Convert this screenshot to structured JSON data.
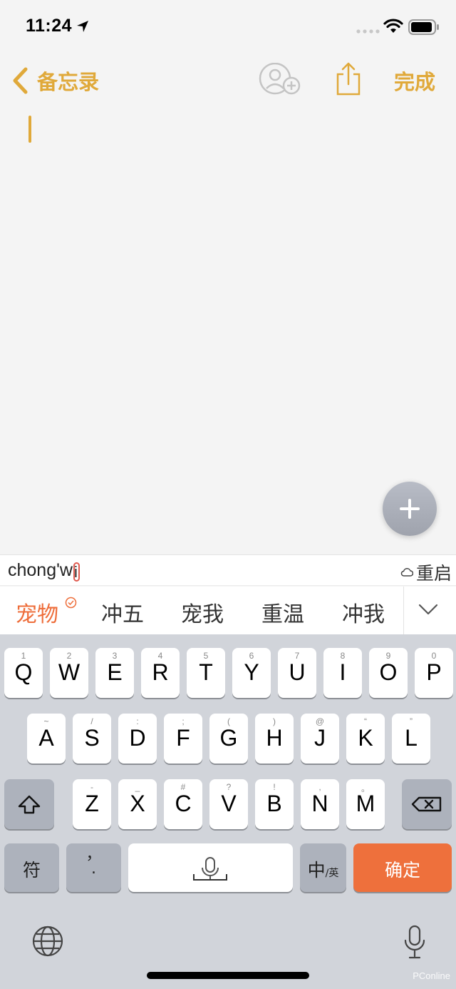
{
  "status_bar": {
    "time": "11:24"
  },
  "nav": {
    "back_label": "备忘录",
    "done_label": "完成"
  },
  "ime": {
    "pinyin_prefix": "chong'w",
    "pinyin_cursor_char": "i",
    "restart_label": "重启"
  },
  "candidates": [
    "宠物",
    "冲五",
    "宠我",
    "重温",
    "冲我"
  ],
  "keyboard": {
    "row1": [
      {
        "ch": "Q",
        "hint": "1"
      },
      {
        "ch": "W",
        "hint": "2"
      },
      {
        "ch": "E",
        "hint": "3"
      },
      {
        "ch": "R",
        "hint": "4"
      },
      {
        "ch": "T",
        "hint": "5"
      },
      {
        "ch": "Y",
        "hint": "6"
      },
      {
        "ch": "U",
        "hint": "7"
      },
      {
        "ch": "I",
        "hint": "8"
      },
      {
        "ch": "O",
        "hint": "9"
      },
      {
        "ch": "P",
        "hint": "0"
      }
    ],
    "row2": [
      {
        "ch": "A",
        "hint": "~"
      },
      {
        "ch": "S",
        "hint": "/"
      },
      {
        "ch": "D",
        "hint": ":"
      },
      {
        "ch": "F",
        "hint": ";"
      },
      {
        "ch": "G",
        "hint": "("
      },
      {
        "ch": "H",
        "hint": ")"
      },
      {
        "ch": "J",
        "hint": "@"
      },
      {
        "ch": "K",
        "hint": "“"
      },
      {
        "ch": "L",
        "hint": "”"
      }
    ],
    "row3": [
      {
        "ch": "Z",
        "hint": "-"
      },
      {
        "ch": "X",
        "hint": "_"
      },
      {
        "ch": "C",
        "hint": "#"
      },
      {
        "ch": "V",
        "hint": "?"
      },
      {
        "ch": "B",
        "hint": "!"
      },
      {
        "ch": "N",
        "hint": ","
      },
      {
        "ch": "M",
        "hint": "。"
      }
    ],
    "symbols_label": "符",
    "punct_label": "，\n.",
    "lang_main": "中",
    "lang_sub": "/英",
    "confirm_label": "确定"
  },
  "watermark": "PConline",
  "colors": {
    "accent": "#e0a93a",
    "ime_orange": "#ee703c"
  },
  "icons": [
    "location-arrow-icon",
    "signal-icon",
    "wifi-icon",
    "battery-icon",
    "chevron-left-icon",
    "add-person-icon",
    "share-icon",
    "plus-icon",
    "cloud-icon",
    "check-circle-icon",
    "chevron-down-icon",
    "shift-icon",
    "backspace-icon",
    "mic-icon",
    "globe-icon"
  ]
}
